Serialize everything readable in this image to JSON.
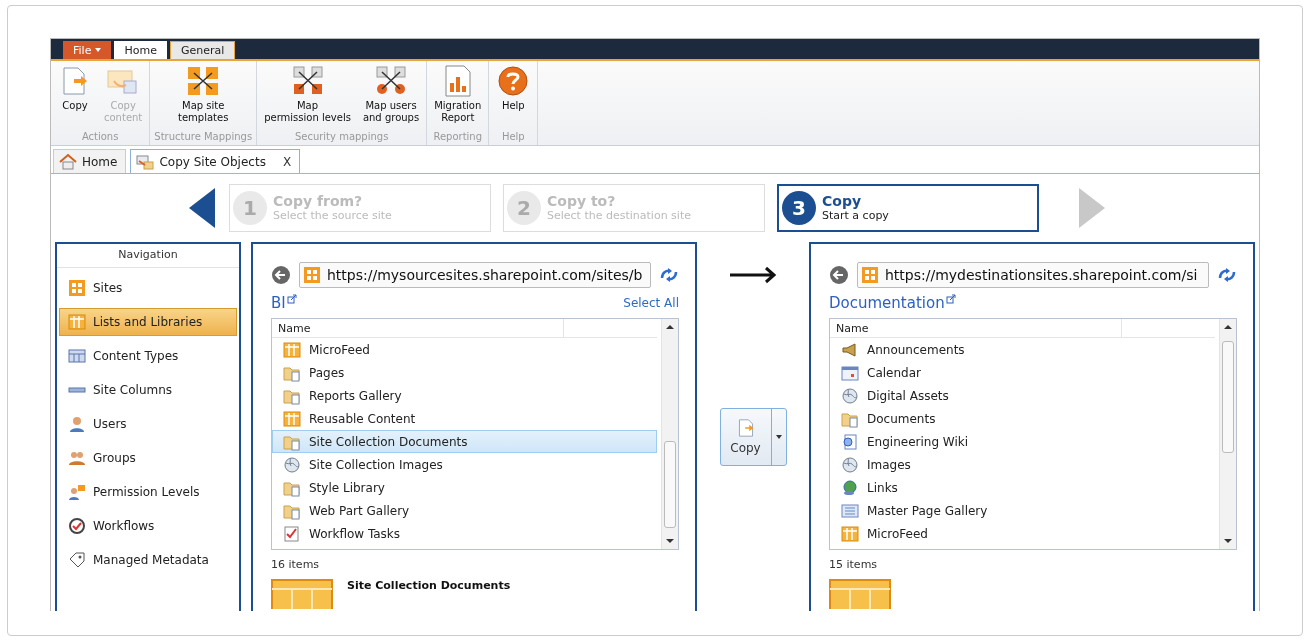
{
  "ribbon_tabs": [
    {
      "label": "File",
      "kind": "file",
      "selected": false
    },
    {
      "label": "Home",
      "kind": "tab",
      "selected": false
    },
    {
      "label": "General",
      "kind": "tab",
      "selected": true
    }
  ],
  "ribbon_groups": [
    {
      "label": "Actions",
      "buttons": [
        {
          "label": "Copy",
          "kind": "copy",
          "disabled": false
        },
        {
          "label": "Copy\ncontent",
          "kind": "copy-content",
          "disabled": true
        }
      ]
    },
    {
      "label": "Structure Mappings",
      "buttons": [
        {
          "label": "Map site\ntemplates",
          "kind": "map-sites",
          "disabled": false
        }
      ]
    },
    {
      "label": "Security mappings",
      "buttons": [
        {
          "label": "Map\npermission levels",
          "kind": "map-locks",
          "disabled": false
        },
        {
          "label": "Map users\nand groups",
          "kind": "map-users",
          "disabled": false
        }
      ]
    },
    {
      "label": "Reporting",
      "buttons": [
        {
          "label": "Migration\nReport",
          "kind": "report",
          "disabled": false
        }
      ]
    },
    {
      "label": "Help",
      "buttons": [
        {
          "label": "Help",
          "kind": "help",
          "disabled": false
        }
      ]
    }
  ],
  "doc_tabs": [
    {
      "label": "Home",
      "kind": "home",
      "selected": false
    },
    {
      "label": "Copy Site Objects",
      "kind": "copy-objects",
      "selected": true,
      "close": "X"
    }
  ],
  "wizard_steps": [
    {
      "number": "1",
      "title": "Copy from?",
      "subtitle": "Select the source site",
      "selected": false
    },
    {
      "number": "2",
      "title": "Copy to?",
      "subtitle": "Select the destination site",
      "selected": false
    },
    {
      "number": "3",
      "title": "Copy",
      "subtitle": "Start a copy",
      "selected": true
    }
  ],
  "navigation": {
    "title": "Navigation",
    "items": [
      {
        "label": "Sites",
        "kind": "sites",
        "selected": false
      },
      {
        "label": "Lists and Libraries",
        "kind": "list",
        "selected": true
      },
      {
        "label": "Content Types",
        "kind": "types",
        "selected": false
      },
      {
        "label": "Site Columns",
        "kind": "columns",
        "selected": false
      },
      {
        "label": "Users",
        "kind": "user",
        "selected": false
      },
      {
        "label": "Groups",
        "kind": "group",
        "selected": false
      },
      {
        "label": "Permission Levels",
        "kind": "perm",
        "selected": false
      },
      {
        "label": "Workflows",
        "kind": "workflow",
        "selected": false
      },
      {
        "label": "Managed Metadata",
        "kind": "metadata",
        "selected": false
      }
    ]
  },
  "source": {
    "url": "https://mysourcesites.sharepoint.com/sites/b",
    "site_title": "BI",
    "select_all": "Select All",
    "column": "Name",
    "items": [
      {
        "label": "MicroFeed",
        "kind": "list",
        "selected": false
      },
      {
        "label": "Pages",
        "kind": "folder",
        "selected": false
      },
      {
        "label": "Reports Gallery",
        "kind": "folder",
        "selected": false
      },
      {
        "label": "Reusable Content",
        "kind": "list",
        "selected": false
      },
      {
        "label": "Site Collection Documents",
        "kind": "folder",
        "selected": true
      },
      {
        "label": "Site Collection Images",
        "kind": "images",
        "selected": false
      },
      {
        "label": "Style Library",
        "kind": "folder",
        "selected": false
      },
      {
        "label": "Web Part Gallery",
        "kind": "folder",
        "selected": false
      },
      {
        "label": "Workflow Tasks",
        "kind": "tasks",
        "selected": false
      }
    ],
    "count": "16 items",
    "preview_title": "Site Collection Documents"
  },
  "copy_button": {
    "label": "Copy"
  },
  "destination": {
    "url": "https://mydestinationsites.sharepoint.com/si",
    "site_title": "Documentation",
    "column": "Name",
    "items": [
      {
        "label": "Announcements",
        "kind": "announce",
        "selected": false
      },
      {
        "label": "Calendar",
        "kind": "calendar",
        "selected": false
      },
      {
        "label": "Digital Assets",
        "kind": "images",
        "selected": false
      },
      {
        "label": "Documents",
        "kind": "folder",
        "selected": false
      },
      {
        "label": "Engineering Wiki",
        "kind": "wiki",
        "selected": false
      },
      {
        "label": "Images",
        "kind": "images",
        "selected": false
      },
      {
        "label": "Links",
        "kind": "links",
        "selected": false
      },
      {
        "label": "Master Page Gallery",
        "kind": "gallery",
        "selected": false
      },
      {
        "label": "MicroFeed",
        "kind": "list",
        "selected": false
      }
    ],
    "count": "15 items"
  }
}
